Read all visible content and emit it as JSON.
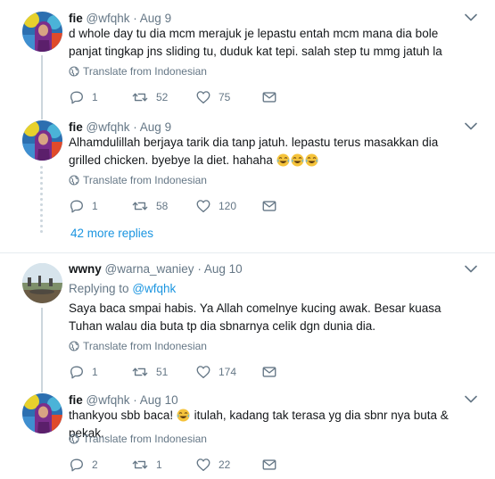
{
  "tweets": [
    {
      "name": "fie",
      "handle": "@wfqhk",
      "time": "Aug 9",
      "text": "d whole day tu dia mcm merajuk je lepastu entah mcm mana dia bole panjat tingkap jns sliding tu, duduk kat tepi. salah step tu mmg jatuh la",
      "translate": "Translate from Indonesian",
      "replies": "1",
      "retweets": "52",
      "likes": "75"
    },
    {
      "name": "fie",
      "handle": "@wfqhk",
      "time": "Aug 9",
      "text": "Alhamdulillah berjaya tarik dia tanp jatuh. lepastu terus masakkan dia grilled chicken. byebye la diet. hahaha",
      "emoji": "😂😂😂",
      "translate": "Translate from Indonesian",
      "replies": "1",
      "retweets": "58",
      "likes": "120"
    },
    {
      "name": "wwny",
      "handle": "@warna_waniey",
      "time": "Aug 10",
      "replying_prefix": "Replying to",
      "replying_to": "@wfqhk",
      "text": "Saya baca smpai habis. Ya Allah comelnye kucing awak. Besar kuasa Tuhan walau dia buta tp dia sbnarnya celik dgn dunia dia.",
      "translate": "Translate from Indonesian",
      "replies": "1",
      "retweets": "51",
      "likes": "174"
    },
    {
      "name": "fie",
      "handle": "@wfqhk",
      "time": "Aug 10",
      "text_before": "thankyou sbb baca!",
      "emoji": "😂",
      "text_after": "itulah, kadang tak terasa yg dia sbnr nya buta & pekak.",
      "translate": "Translate from Indonesian",
      "replies": "2",
      "retweets": "1",
      "likes": "22"
    }
  ],
  "more_replies": "42 more replies",
  "colors": {
    "accent": "#1b95e0",
    "muted": "#657786",
    "text": "#14171a",
    "divider": "#e6ecf0"
  }
}
